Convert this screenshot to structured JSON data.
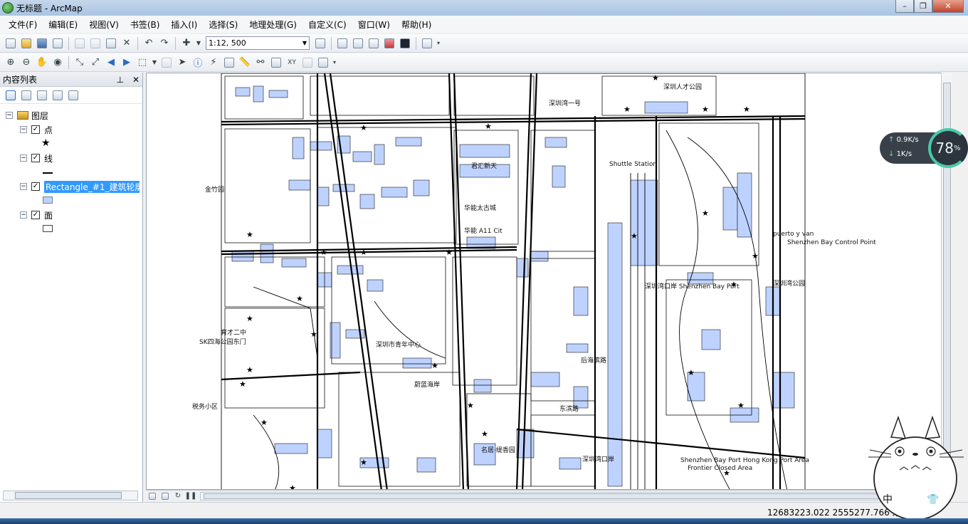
{
  "window": {
    "title": "无标题 - ArcMap"
  },
  "menus": [
    "文件(F)",
    "编辑(E)",
    "视图(V)",
    "书签(B)",
    "插入(I)",
    "选择(S)",
    "地理处理(G)",
    "自定义(C)",
    "窗口(W)",
    "帮助(H)"
  ],
  "toolbar": {
    "scale": "1:12, 500"
  },
  "toc": {
    "title": "内容列表",
    "root": "图层",
    "layers": [
      {
        "name": "点",
        "checked": true
      },
      {
        "name": "线",
        "checked": true
      },
      {
        "name": "Rectangle_#1_建筑轮廓1",
        "checked": true
      },
      {
        "name": "面",
        "checked": true
      }
    ]
  },
  "map": {
    "labels": [
      "深圳人才公园",
      "君汇新天",
      "华能太古城",
      "华能 A11 Cit",
      "深圳市青年中心",
      "深圳湾口岸 Shenzhen Bay Port",
      "Shenzhen Bay Control Point",
      "Shuttle Station",
      "金竹园",
      "税务小区",
      "SK四海公园东门",
      "育才二中",
      "蔚蓝海岸",
      "名居·缇香园",
      "深圳湾口岸",
      "Shenzhen Bay Port Hong Kong Port Area",
      "Frontier Closed Area",
      "东滨路",
      "深圳湾一号",
      "puerto y van",
      "后海滨路",
      "深圳湾公园"
    ]
  },
  "status": {
    "coordinates": "12683223.022  2555277.766 米"
  },
  "overlay": {
    "upload": "0.9K/s",
    "download": "1K/s",
    "cpu": "78",
    "cpu_unit": "%",
    "ime": "中"
  }
}
